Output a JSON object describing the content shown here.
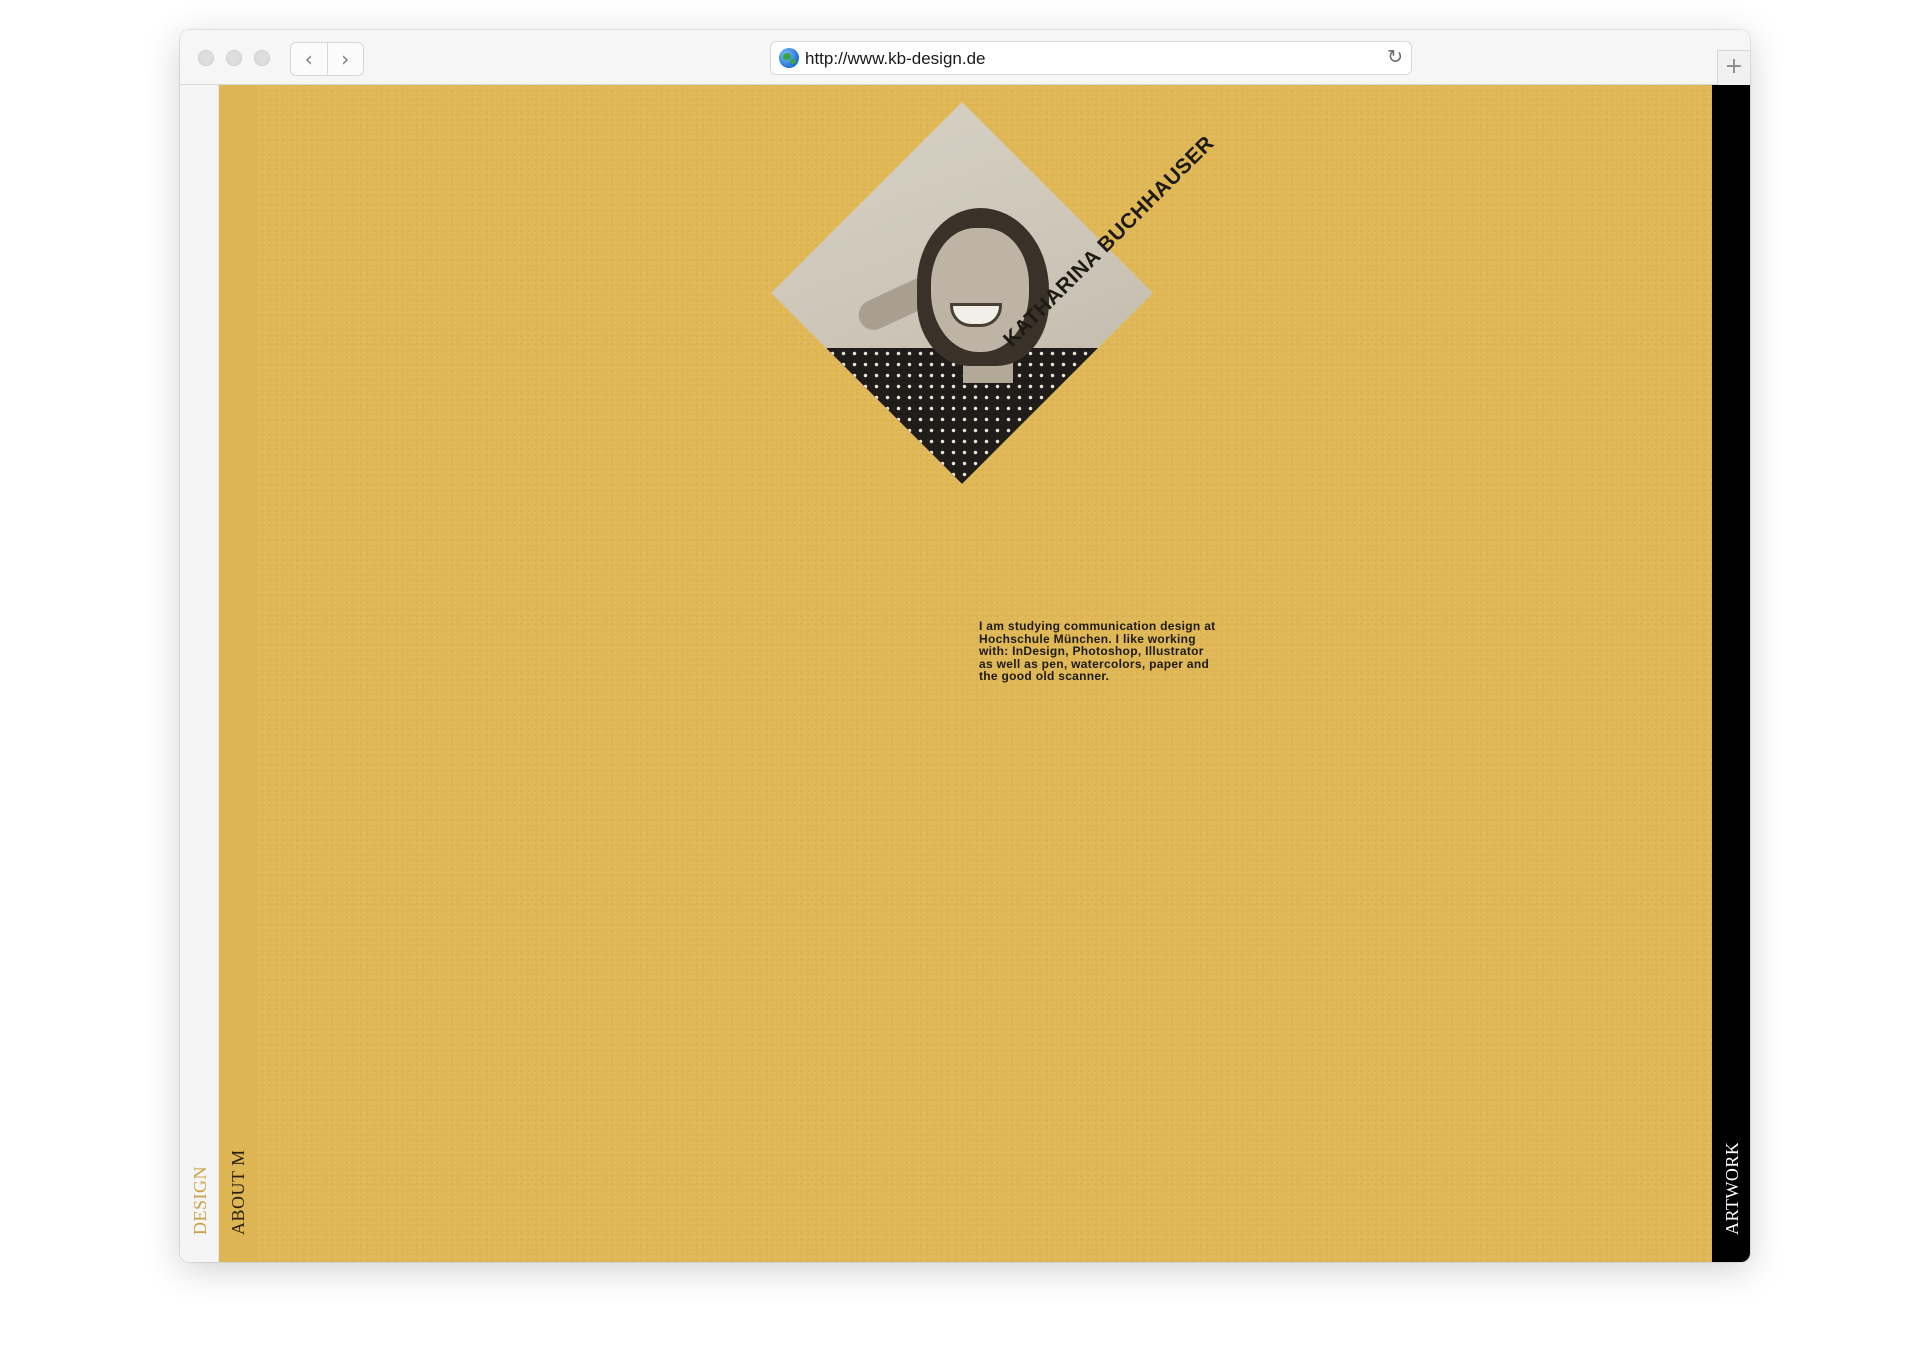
{
  "browser": {
    "url": "http://www.kb-design.de",
    "back_glyph": "‹",
    "forward_glyph": "›",
    "reload_glyph": "↻",
    "newtab_glyph": "+"
  },
  "side_nav": {
    "design_label": "DESIGN",
    "about_label": "ABOUT ME",
    "artwork_label": "ARTWORK"
  },
  "profile": {
    "name": "KATHARINA BUCHHAUSER",
    "bio": "I am studying communication design at Hochschule München. I like working with: InDesign, Photoshop, Illustrator as well as pen, watercolors, paper and the good old scanner."
  },
  "colors": {
    "background_gold": "#e0b755",
    "text_dark": "#1d1a14",
    "artwork_panel": "#000000"
  }
}
